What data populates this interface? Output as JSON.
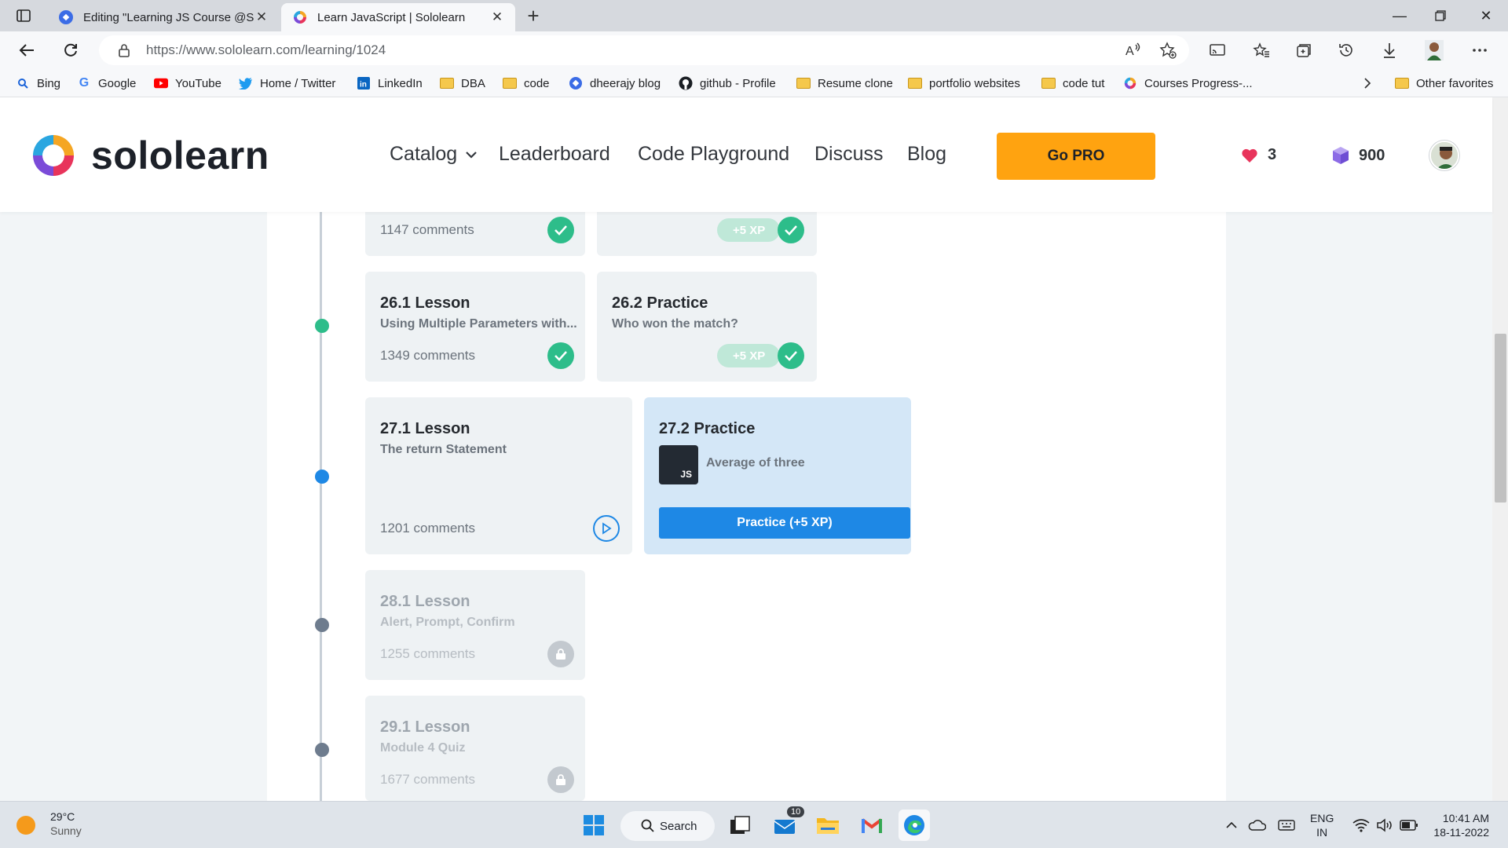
{
  "browser": {
    "tabs": [
      {
        "title": "Editing \"Learning JS Course @Sc",
        "active": false
      },
      {
        "title": "Learn JavaScript | Sololearn",
        "active": true
      }
    ],
    "url_host": "https://www.sololearn.com",
    "url_path": "/learning/1024",
    "bookmarks": [
      {
        "label": "Bing",
        "icon": "bing-search-icon"
      },
      {
        "label": "Google",
        "icon": "google-icon"
      },
      {
        "label": "YouTube",
        "icon": "youtube-icon"
      },
      {
        "label": "Home / Twitter",
        "icon": "twitter-icon"
      },
      {
        "label": "LinkedIn",
        "icon": "linkedin-icon"
      },
      {
        "label": "DBA",
        "icon": "folder-icon"
      },
      {
        "label": "code",
        "icon": "folder-icon"
      },
      {
        "label": "dheerajy blog",
        "icon": "blog-icon"
      },
      {
        "label": "github - Profile",
        "icon": "github-icon"
      },
      {
        "label": "Resume clone",
        "icon": "folder-icon"
      },
      {
        "label": "portfolio websites",
        "icon": "folder-icon"
      },
      {
        "label": "code tut",
        "icon": "folder-icon"
      },
      {
        "label": "Courses Progress-...",
        "icon": "sololearn-icon"
      }
    ],
    "other_favorites": "Other favorites"
  },
  "site": {
    "brand": "sololearn",
    "nav": {
      "catalog": "Catalog",
      "leaderboard": "Leaderboard",
      "playground": "Code Playground",
      "discuss": "Discuss",
      "blog": "Blog"
    },
    "go_pro": "Go PRO",
    "hearts": "3",
    "bits": "900",
    "colors": {
      "accent": "#ffa310",
      "primary": "#1e88e5",
      "success": "#2dbd8a"
    }
  },
  "lessons": {
    "top_left_comments": "1147 comments",
    "top_right_xp": "+5 XP",
    "l26_1": {
      "title": "26.1 Lesson",
      "subtitle": "Using Multiple Parameters with...",
      "comments": "1349 comments"
    },
    "l26_2": {
      "title": "26.2 Practice",
      "subtitle": "Who won the match?",
      "xp": "+5 XP"
    },
    "l27_1": {
      "title": "27.1 Lesson",
      "subtitle": "The return Statement",
      "comments": "1201 comments"
    },
    "l27_2": {
      "title": "27.2 Practice",
      "badge": "JS",
      "task": "Average of three",
      "button": "Practice (+5 XP)"
    },
    "l28_1": {
      "title": "28.1 Lesson",
      "subtitle": "Alert, Prompt, Confirm",
      "comments": "1255 comments"
    },
    "l29_1": {
      "title": "29.1 Lesson",
      "subtitle": "Module 4 Quiz",
      "comments": "1677 comments"
    }
  },
  "taskbar": {
    "weather_temp": "29°C",
    "weather_desc": "Sunny",
    "search": "Search",
    "mail_badge": "10",
    "lang_1": "ENG",
    "lang_2": "IN",
    "time": "10:41 AM",
    "date": "18-11-2022"
  }
}
